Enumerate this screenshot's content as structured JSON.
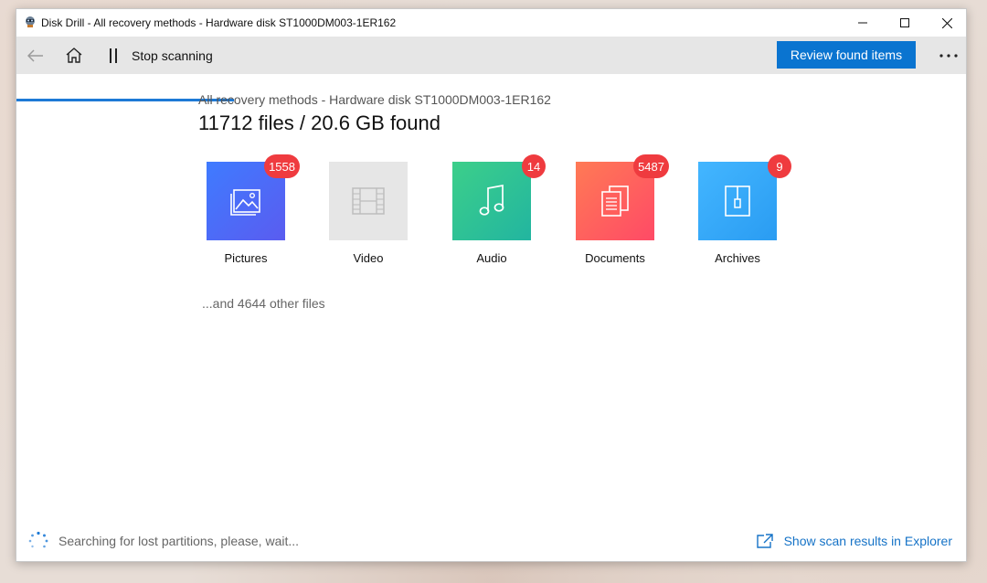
{
  "window": {
    "title": "Disk Drill - All recovery methods - Hardware disk ST1000DM003-1ER162",
    "controls": {
      "minimize": "minimize-icon",
      "maximize": "maximize-icon",
      "close": "close-icon"
    }
  },
  "toolbar": {
    "back_icon": "back-arrow-icon",
    "home_icon": "home-icon",
    "pause_icon": "pause-icon",
    "stop_label": "Stop scanning",
    "review_label": "Review found items",
    "more_icon": "more-icon",
    "accent": "#0a74d0"
  },
  "main": {
    "subtitle": "All recovery methods - Hardware disk ST1000DM003-1ER162",
    "headline": "11712 files / 20.6 GB found",
    "categories": [
      {
        "label": "Pictures",
        "count": "1558",
        "icon": "picture-icon",
        "color_from": "#3f7bff",
        "color_to": "#5a5cf0"
      },
      {
        "label": "Video",
        "count": "",
        "icon": "video-icon",
        "color_from": "#e6e6e6",
        "color_to": "#e6e6e6"
      },
      {
        "label": "Audio",
        "count": "14",
        "icon": "music-note-icon",
        "color_from": "#3ccf8a",
        "color_to": "#22b5a0"
      },
      {
        "label": "Documents",
        "count": "5487",
        "icon": "document-icon",
        "color_from": "#ff7a55",
        "color_to": "#ff4a66"
      },
      {
        "label": "Archives",
        "count": "9",
        "icon": "zip-archive-icon",
        "color_from": "#43b6ff",
        "color_to": "#2a9cf2"
      }
    ],
    "other_files": "...and 4644 other files"
  },
  "status": {
    "spinner_icon": "spinner-icon",
    "text": "Searching for lost partitions, please, wait...",
    "explorer_icon": "external-link-icon",
    "explorer_link": "Show scan results in Explorer"
  }
}
